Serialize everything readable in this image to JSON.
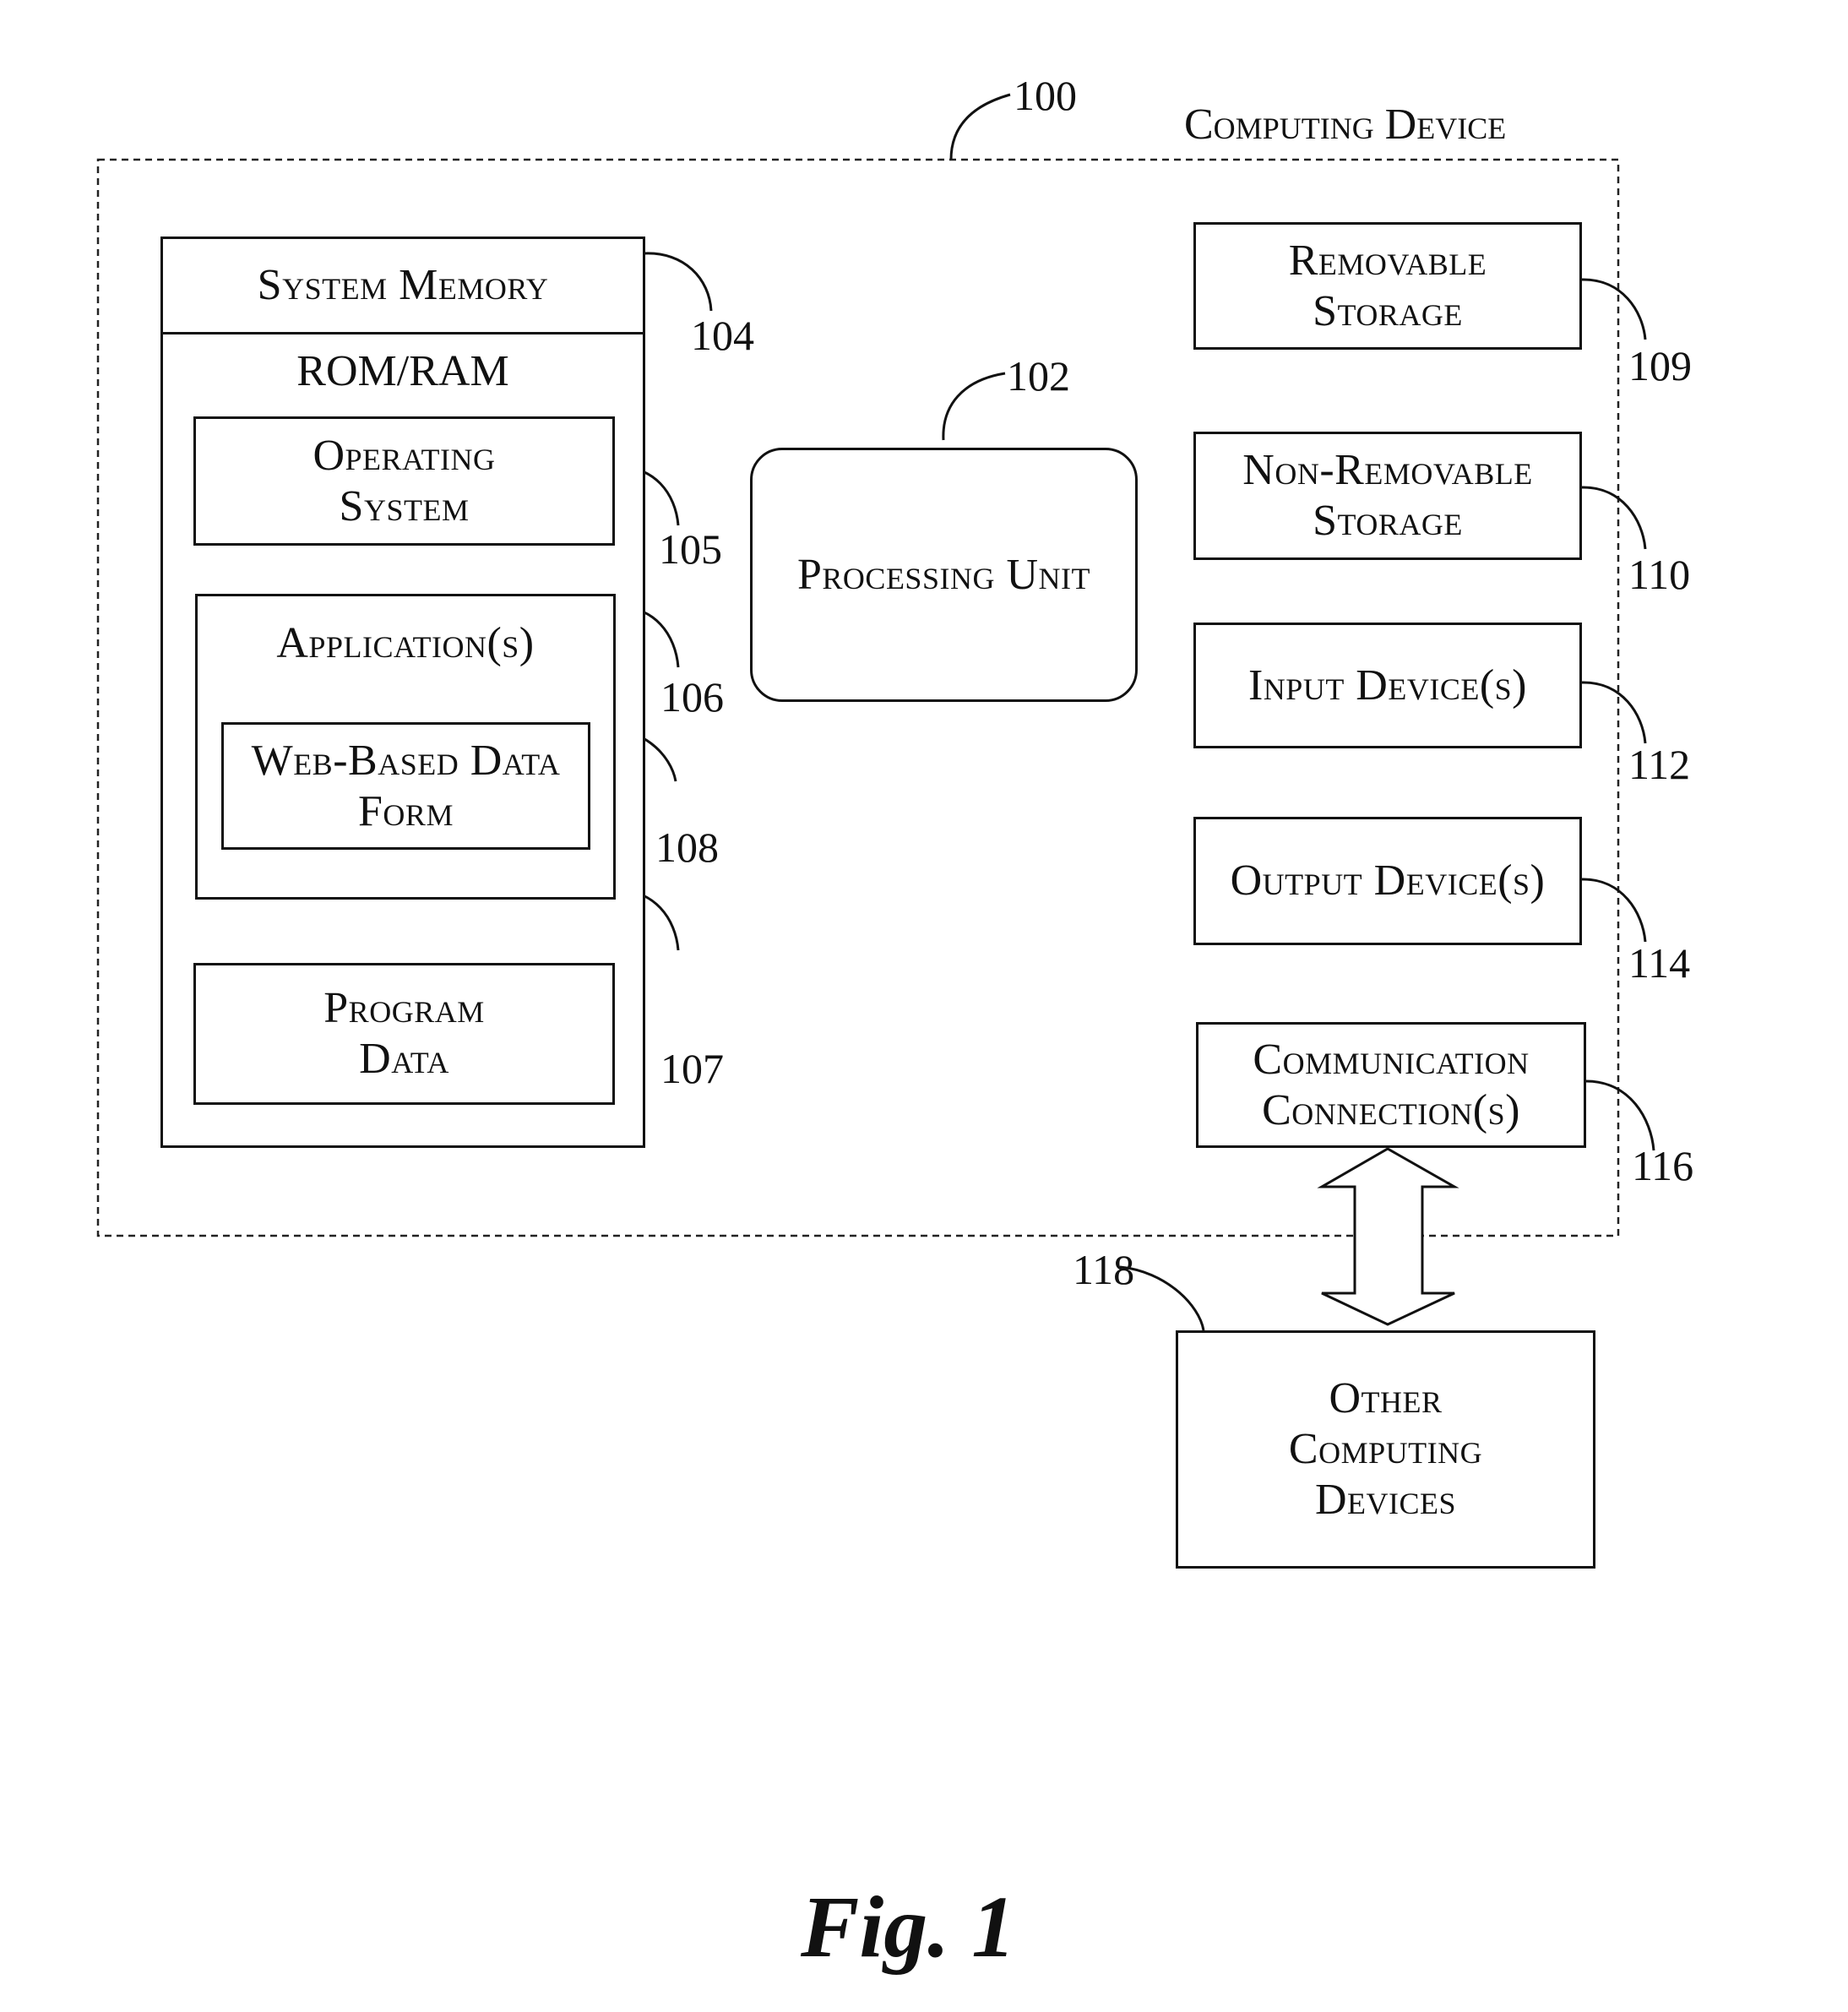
{
  "figure": {
    "title": "Computing Device",
    "caption": "Fig. 1",
    "device_ref": "100"
  },
  "system_memory": {
    "header": "System Memory",
    "ref": "104",
    "subheader": "ROM/RAM",
    "operating_system": {
      "line1": "Operating",
      "line2": "System",
      "ref": "105"
    },
    "applications": {
      "label": "Application(s)",
      "ref": "106"
    },
    "web_form": {
      "line1": "Web-Based Data",
      "line2": "Form",
      "ref": "108"
    },
    "program_data": {
      "line1": "Program",
      "line2": "Data",
      "ref": "107"
    }
  },
  "processing_unit": {
    "label": "Processing Unit",
    "ref": "102"
  },
  "peripherals": {
    "removable_storage": {
      "line1": "Removable",
      "line2": "Storage",
      "ref": "109"
    },
    "non_removable_storage": {
      "line1": "Non-Removable",
      "line2": "Storage",
      "ref": "110"
    },
    "input_devices": {
      "label": "Input Device(s)",
      "ref": "112"
    },
    "output_devices": {
      "label": "Output Device(s)",
      "ref": "114"
    },
    "communication_connections": {
      "line1": "Communication",
      "line2": "Connection(s)",
      "ref": "116"
    }
  },
  "other_computing_devices": {
    "line1": "Other",
    "line2": "Computing",
    "line3": "Devices",
    "ref": "118"
  },
  "connector_icon": "bidirectional-arrow"
}
